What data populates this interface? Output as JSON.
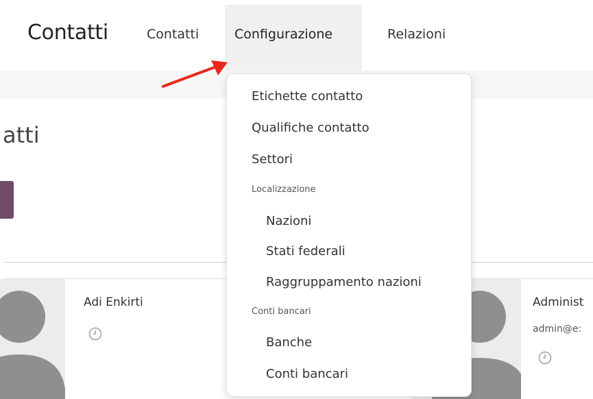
{
  "navbar": {
    "app_title": "Contatti",
    "items": [
      {
        "label": "Contatti"
      },
      {
        "label": "Configurazione"
      },
      {
        "label": "Relazioni"
      }
    ]
  },
  "page": {
    "heading_fragment": "atti"
  },
  "cards": [
    {
      "name": "Adi Enkirti"
    },
    {
      "name": "Administ",
      "email": "admin@e:"
    }
  ],
  "dropdown": {
    "items": [
      {
        "label": "Etichette contatto"
      },
      {
        "label": "Qualifiche contatto"
      },
      {
        "label": "Settori"
      }
    ],
    "sections": [
      {
        "header": "Localizzazione",
        "items": [
          {
            "label": "Nazioni"
          },
          {
            "label": "Stati federali"
          },
          {
            "label": "Raggruppamento nazioni"
          }
        ]
      },
      {
        "header": "Conti bancari",
        "items": [
          {
            "label": "Banche"
          },
          {
            "label": "Conti bancari"
          }
        ]
      }
    ]
  },
  "colors": {
    "brand_purple": "#714B67",
    "arrow_red": "#e8281e",
    "active_nav_bg": "#f0f0f0"
  }
}
